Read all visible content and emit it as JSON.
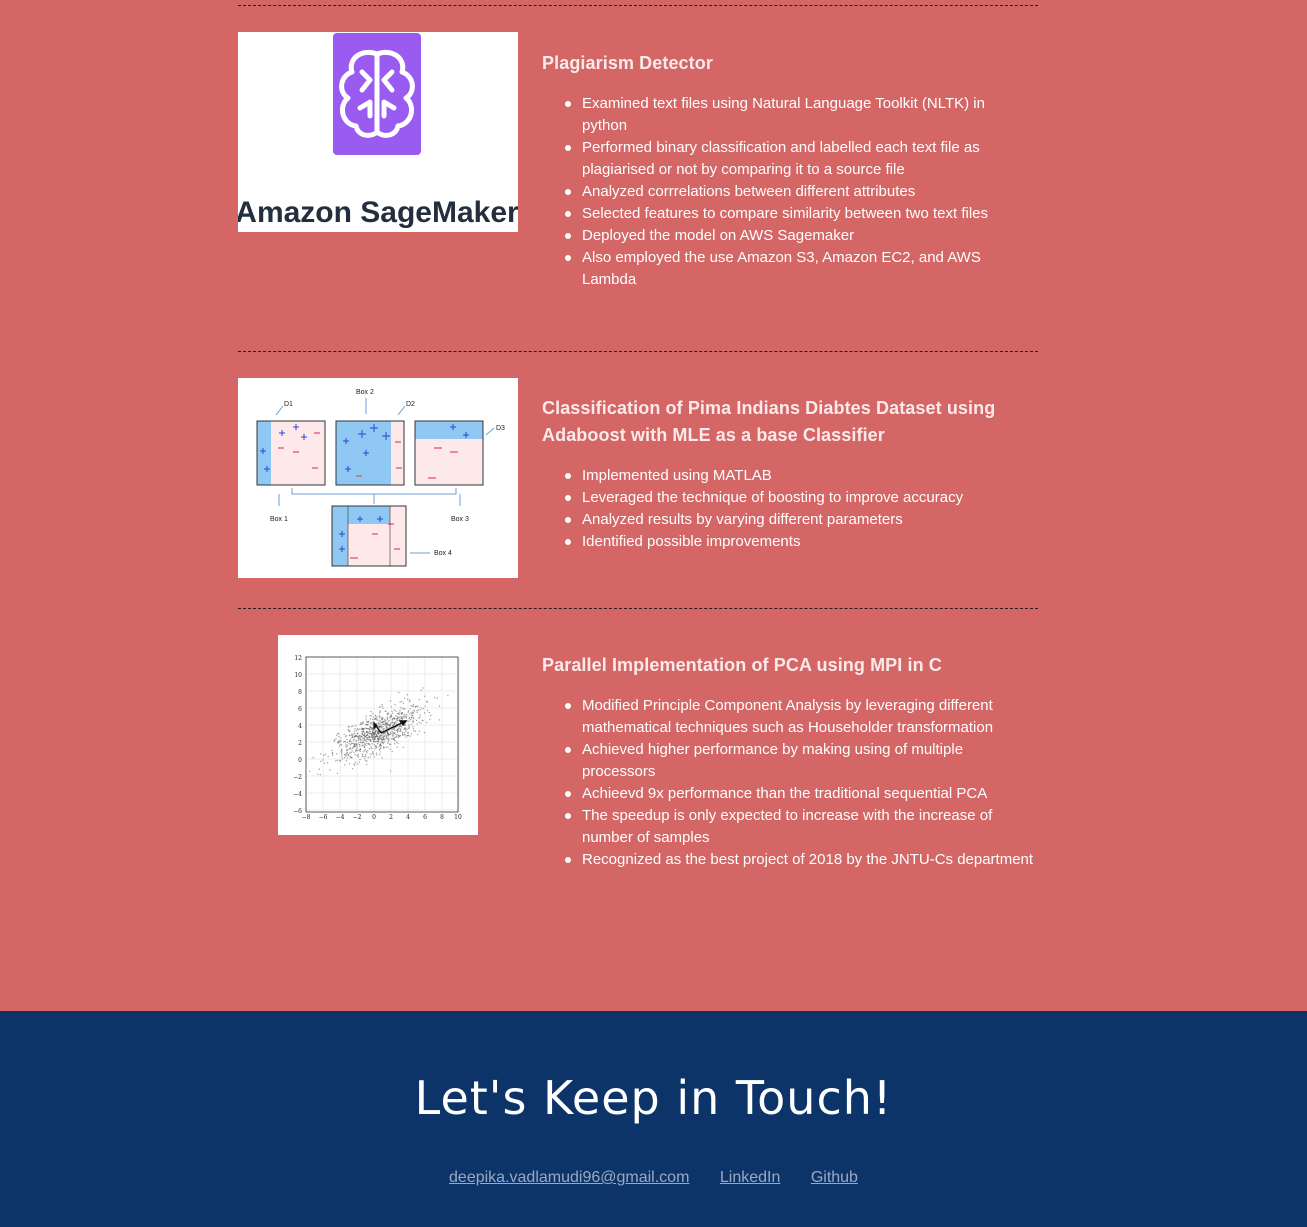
{
  "projects": [
    {
      "title": "Plagiarism Detector",
      "image_caption": "Amazon SageMaker",
      "image_icon": "brain-icon",
      "points": [
        "Examined text files using Natural Language Toolkit (NLTK) in python",
        "Performed binary classification and labelled each text file as plagiarised or not by comparing it to a source file",
        "Analyzed corrrelations between different attributes",
        "Selected features to compare similarity between two text files",
        "Deployed the model on AWS Sagemaker",
        "Also employed the use Amazon S3, Amazon EC2, and AWS Lambda"
      ]
    },
    {
      "title": "Classification of Pima Indians Diabtes Dataset using Adaboost with MLE as a base Classifier",
      "image_labels": {
        "box1": "Box 1",
        "box2": "Box 2",
        "box3": "Box 3",
        "box4": "Box 4",
        "d1": "D1",
        "d2": "D2",
        "d3": "D3"
      },
      "points": [
        "Implemented using MATLAB",
        "Leveraged the technique of boosting to improve accuracy",
        "Analyzed results by varying different parameters",
        "Identified possible improvements"
      ]
    },
    {
      "title": "Parallel Implementation of PCA using MPI in C",
      "plot_ticks": {
        "x": [
          "−8",
          "−6",
          "−4",
          "−2",
          "0",
          "2",
          "4",
          "6",
          "8",
          "10"
        ],
        "y": [
          "12",
          "10",
          "8",
          "6",
          "4",
          "2",
          "0",
          "−2",
          "−4",
          "−6"
        ]
      },
      "points": [
        "Modified Principle Component Analysis by leveraging different mathematical techniques such as Householder transformation",
        "Achieved higher performance by making using of multiple processors",
        "Achieevd 9x performance than the traditional sequential PCA",
        "The speedup is only expected to increase with the increase of number of samples",
        "Recognized as the best project of 2018 by the JNTU-Cs department"
      ]
    }
  ],
  "footer": {
    "title": "Let's Keep in Touch!",
    "email": "deepika.vadlamudi96@gmail.com",
    "linkedin": "LinkedIn",
    "github": "Github"
  },
  "colors": {
    "section_bg": "#d46666",
    "footer_bg": "#0d3468",
    "link": "#9aa9c3",
    "sagemaker_purple": "#9a5cf0"
  }
}
